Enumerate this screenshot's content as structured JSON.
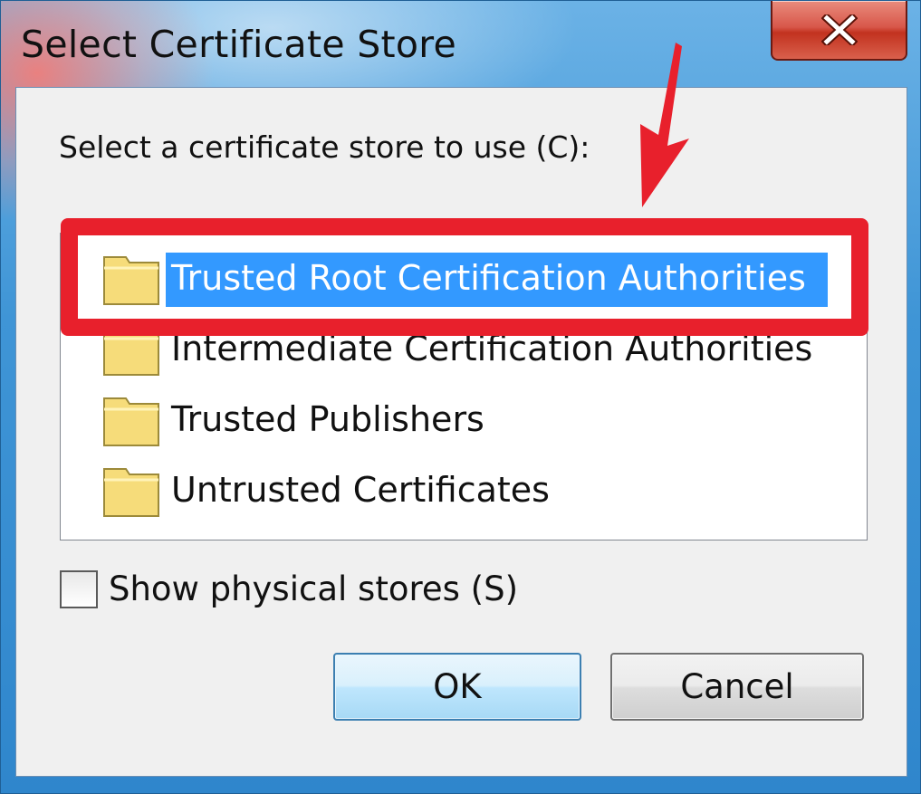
{
  "window": {
    "title": "Select Certificate Store",
    "close_glyph": "X"
  },
  "dialog": {
    "prompt": "Select a certificate store to use (C):",
    "stores": [
      {
        "label": "Trusted Root Certification Authorities",
        "icon": "folder-icon",
        "selected": true
      },
      {
        "label": "Intermediate Certification Authorities",
        "icon": "folder-icon",
        "selected": false
      },
      {
        "label": "Trusted Publishers",
        "icon": "folder-icon",
        "selected": false
      },
      {
        "label": "Untrusted Certificates",
        "icon": "folder-icon",
        "selected": false
      }
    ],
    "show_physical_label": "Show physical stores (S)",
    "show_physical_checked": false,
    "ok_label": "OK",
    "cancel_label": "Cancel"
  },
  "colors": {
    "selection": "#3399ff",
    "annotation": "#e8202c",
    "folder": "#f6dc7a"
  }
}
